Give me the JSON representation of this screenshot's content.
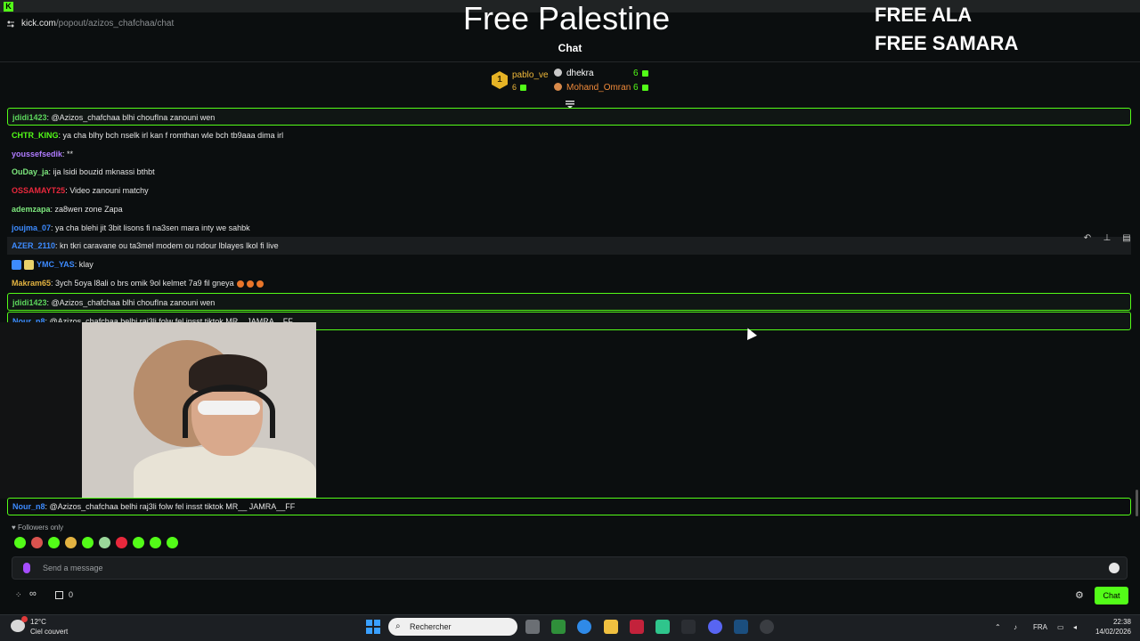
{
  "browser": {
    "url_host": "kick.com",
    "url_path": "/popout/azizos_chafchaa/chat"
  },
  "overlay": {
    "headline": "Free Palestine",
    "free_line_1": "FREE ALA",
    "free_line_2": "FREE SAMARA"
  },
  "chat": {
    "title": "Chat",
    "gifters": [
      {
        "rank": "1",
        "name": "pablo_ve",
        "count": "6"
      },
      {
        "name": "dhekra",
        "count": "6"
      },
      {
        "name": "Mohand_Omran",
        "count": "6"
      }
    ],
    "messages": [
      {
        "user": "jdidi1423",
        "color": "#5cd65c",
        "text": "@Azizos_chafchaa blhi choufIna zanouni wen",
        "highlight": true
      },
      {
        "user": "CHTR_KING",
        "color": "#53fc18",
        "text": "ya cha blhy bch nselk irl kan f romthan wle bch tb9aaa dima irl"
      },
      {
        "user": "youssefsedik",
        "color": "#b07bff",
        "text": "**"
      },
      {
        "user": "OuDay_ja",
        "color": "#7de87d",
        "text": "ija lsidi bouzid mknassi bthbt"
      },
      {
        "user": "OSSAMAYT25",
        "color": "#e8283c",
        "text": "Video zanouni matchy"
      },
      {
        "user": "ademzapa",
        "color": "#7de87d",
        "text": "za8wen zone Zapa"
      },
      {
        "user": "joujma_07",
        "color": "#3d8bff",
        "text": "ya cha blehi jit 3bit lisons fi na3sen mara inty we sahbk"
      },
      {
        "user": "AZER_2110",
        "color": "#3d8bff",
        "text": "kn tkri caravane ou ta3mel modem ou ndour lblayes lkol fi live",
        "hover": true
      },
      {
        "user": "YMC_YAS",
        "color": "#3d8bff",
        "text": "klay"
      },
      {
        "user": "Makram65",
        "color": "#e3b341",
        "text": "3ych 5oya l8ali o brs omik 9ol kelmet 7a9 fil gneya"
      },
      {
        "user": "jdidi1423",
        "color": "#5cd65c",
        "text": "@Azizos_chafchaa blhi choufIna zanouni wen",
        "highlight": true
      },
      {
        "user": "Nour_n8",
        "color": "#3d8bff",
        "text": "@Azizos_chafchaa belhi raj3li folw fel insst tiktok MR__JAMRA__FF",
        "highlight": true
      }
    ],
    "bottom_message": {
      "user": "Nour_n8",
      "color": "#3d8bff",
      "text": "@Azizos_chafchaa belhi raj3li folw fel insst tiktok MR__ JAMRA__FF"
    },
    "followers_label": "Followers only",
    "input_placeholder": "Send a message",
    "gift_count": "0",
    "chat_button": "Chat"
  },
  "taskbar": {
    "temp": "12°C",
    "condition": "Ciel couvert",
    "search": "Rechercher",
    "lang": "FRA",
    "time": "22:38",
    "date": "14/02/2026"
  },
  "colors": {
    "accent": "#53fc18",
    "background": "#0b0e0f"
  }
}
